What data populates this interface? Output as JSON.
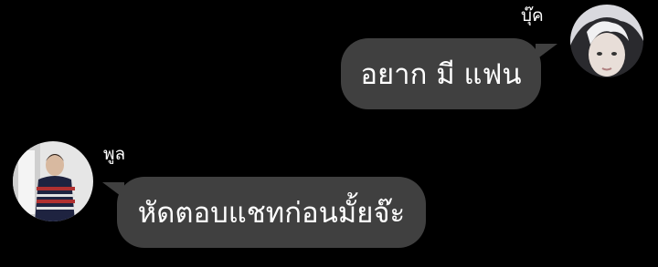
{
  "messages": [
    {
      "sender": "บุ๊ค",
      "text": "อยาก มี แฟน",
      "avatar_icon": "profile-photo-light-hair"
    },
    {
      "sender": "พูล",
      "text": "หัดตอบแชทก่อนมั้ยจ๊ะ",
      "avatar_icon": "profile-photo-striped-sweater"
    }
  ],
  "colors": {
    "background": "#000000",
    "bubble": "#404040",
    "text": "#ffffff"
  }
}
